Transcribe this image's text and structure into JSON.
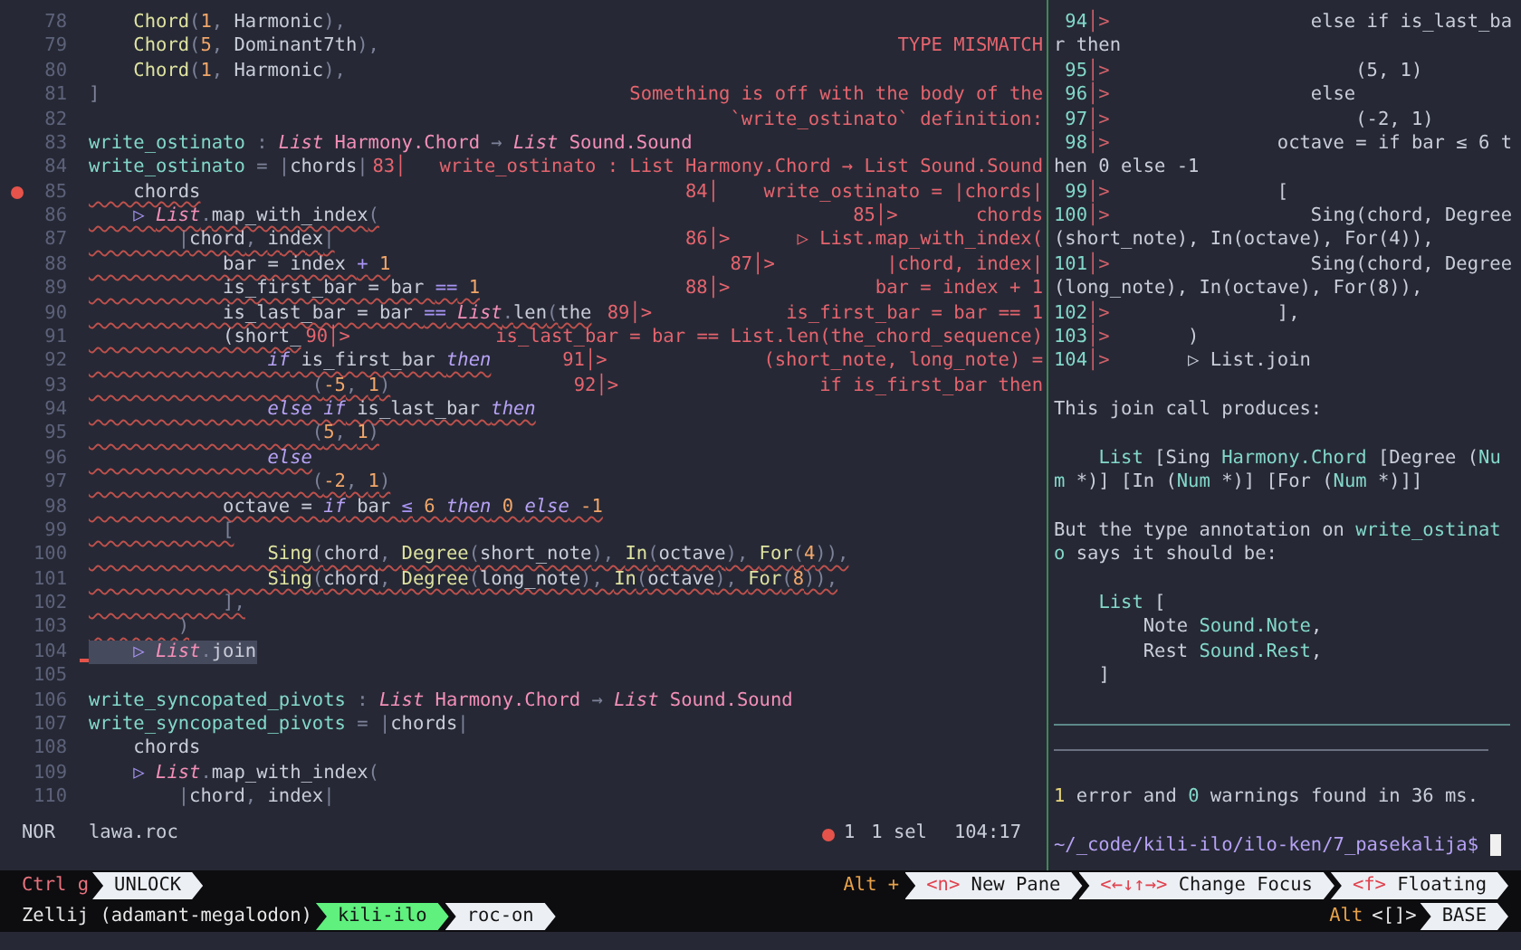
{
  "editor": {
    "lines": [
      {
        "number": "78",
        "tokens": [
          {
            "kind": "fn",
            "text": "    Chord"
          },
          {
            "kind": "p",
            "text": "("
          },
          {
            "kind": "num",
            "text": "1"
          },
          {
            "kind": "p",
            "text": ", "
          },
          {
            "kind": "pl",
            "text": "Harmonic"
          },
          {
            "kind": "p",
            "text": "),"
          }
        ],
        "error": false,
        "breakpoint": false,
        "selected": false
      },
      {
        "number": "79",
        "tokens": [
          {
            "kind": "fn",
            "text": "    Chord"
          },
          {
            "kind": "p",
            "text": "("
          },
          {
            "kind": "num",
            "text": "5"
          },
          {
            "kind": "p",
            "text": ", "
          },
          {
            "kind": "pl",
            "text": "Dominant7th"
          },
          {
            "kind": "p",
            "text": "),"
          }
        ],
        "diagnostic": "TYPE MISMATCH",
        "error": false,
        "breakpoint": false,
        "selected": false
      },
      {
        "number": "80",
        "tokens": [
          {
            "kind": "fn",
            "text": "    Chord"
          },
          {
            "kind": "p",
            "text": "("
          },
          {
            "kind": "num",
            "text": "1"
          },
          {
            "kind": "p",
            "text": ", "
          },
          {
            "kind": "pl",
            "text": "Harmonic"
          },
          {
            "kind": "p",
            "text": "),"
          }
        ],
        "error": false,
        "breakpoint": false,
        "selected": false
      },
      {
        "number": "81",
        "tokens": [
          {
            "kind": "p",
            "text": "]"
          }
        ],
        "diagnostic": "Something is off with the body of the",
        "error": false,
        "breakpoint": false,
        "selected": false
      },
      {
        "number": "82",
        "diagnostic": "`write_ostinato` definition:",
        "error": false,
        "breakpoint": false,
        "selected": false
      },
      {
        "number": "83",
        "tokens": [
          {
            "kind": "def",
            "text": "write_ostinato"
          },
          {
            "kind": "p",
            "text": " : "
          },
          {
            "kind": "ti",
            "text": "List"
          },
          {
            "kind": "ty",
            "text": " Harmony.Chord"
          },
          {
            "kind": "p",
            "text": " → "
          },
          {
            "kind": "ti",
            "text": "List"
          },
          {
            "kind": "ty",
            "text": " Sound.Sound"
          }
        ],
        "error": false,
        "breakpoint": false,
        "selected": false
      },
      {
        "number": "84",
        "tokens": [
          {
            "kind": "def",
            "text": "write_ostinato"
          },
          {
            "kind": "p",
            "text": " = |"
          },
          {
            "kind": "pl",
            "text": "chords"
          },
          {
            "kind": "p",
            "text": "|"
          }
        ],
        "diagnostic": "83│   write_ostinato : List Harmony.Chord → List Sound.Sound",
        "error": false,
        "breakpoint": false,
        "selected": false
      },
      {
        "number": "85",
        "tokens": [
          {
            "kind": "pl",
            "text": "    chords"
          }
        ],
        "diagnostic": "84│    write_ostinato = |chords|",
        "error": true,
        "breakpoint": true,
        "selected": false
      },
      {
        "number": "86",
        "tokens": [
          {
            "kind": "op",
            "text": "    ▷ "
          },
          {
            "kind": "ti",
            "text": "List"
          },
          {
            "kind": "p",
            "text": "."
          },
          {
            "kind": "pl",
            "text": "map_with_index"
          },
          {
            "kind": "p",
            "text": "("
          }
        ],
        "diagnostic": "85│>       chords",
        "error": true,
        "breakpoint": false,
        "selected": false
      },
      {
        "number": "87",
        "tokens": [
          {
            "kind": "p",
            "text": "        |"
          },
          {
            "kind": "pl",
            "text": "chord"
          },
          {
            "kind": "p",
            "text": ", "
          },
          {
            "kind": "pl",
            "text": "index"
          },
          {
            "kind": "p",
            "text": "|"
          }
        ],
        "diagnostic": "86│>      ▷ List.map_with_index(",
        "error": true,
        "breakpoint": false,
        "selected": false
      },
      {
        "number": "88",
        "tokens": [
          {
            "kind": "pl",
            "text": "            bar = index "
          },
          {
            "kind": "op",
            "text": "+"
          },
          {
            "kind": "num",
            "text": " 1"
          }
        ],
        "diagnostic": "87│>          |chord, index|",
        "error": true,
        "breakpoint": false,
        "selected": false
      },
      {
        "number": "89",
        "tokens": [
          {
            "kind": "pl",
            "text": "            is_first_bar = bar "
          },
          {
            "kind": "op",
            "text": "=="
          },
          {
            "kind": "num",
            "text": " 1"
          }
        ],
        "diagnostic": "88│>             bar = index + 1",
        "error": true,
        "breakpoint": false,
        "selected": false
      },
      {
        "number": "90",
        "tokens": [
          {
            "kind": "pl",
            "text": "            is_last_bar = bar "
          },
          {
            "kind": "op",
            "text": "=="
          },
          {
            "kind": "ti",
            "text": " List"
          },
          {
            "kind": "p",
            "text": "."
          },
          {
            "kind": "pl",
            "text": "len"
          },
          {
            "kind": "p",
            "text": "("
          },
          {
            "kind": "pl",
            "text": "the"
          }
        ],
        "diagnostic": "89│>            is_first_bar = bar == 1",
        "error": true,
        "breakpoint": false,
        "selected": false
      },
      {
        "number": "91",
        "tokens": [
          {
            "kind": "pl",
            "text": "            (short_"
          }
        ],
        "diagnostic": "90│>             is_last_bar = bar == List.len(the_chord_sequence)",
        "error": true,
        "breakpoint": false,
        "selected": false
      },
      {
        "number": "92",
        "tokens": [
          {
            "kind": "kw",
            "text": "                if"
          },
          {
            "kind": "pl",
            "text": " is_first_bar "
          },
          {
            "kind": "kw",
            "text": "then"
          }
        ],
        "diagnostic": "91│>              (short_note, long_note) =",
        "error": true,
        "breakpoint": false,
        "selected": false
      },
      {
        "number": "93",
        "tokens": [
          {
            "kind": "p",
            "text": "                    ("
          },
          {
            "kind": "num",
            "text": "-5"
          },
          {
            "kind": "p",
            "text": ", "
          },
          {
            "kind": "num",
            "text": "1"
          },
          {
            "kind": "p",
            "text": ")"
          }
        ],
        "diagnostic": "92│>                  if is_first_bar then",
        "error": true,
        "breakpoint": false,
        "selected": false
      },
      {
        "number": "94",
        "tokens": [
          {
            "kind": "kw",
            "text": "                else if"
          },
          {
            "kind": "pl",
            "text": " is_last_bar "
          },
          {
            "kind": "kw",
            "text": "then"
          }
        ],
        "error": true,
        "breakpoint": false,
        "selected": false
      },
      {
        "number": "95",
        "tokens": [
          {
            "kind": "p",
            "text": "                    ("
          },
          {
            "kind": "num",
            "text": "5"
          },
          {
            "kind": "p",
            "text": ", "
          },
          {
            "kind": "num",
            "text": "1"
          },
          {
            "kind": "p",
            "text": ")"
          }
        ],
        "error": true,
        "breakpoint": false,
        "selected": false
      },
      {
        "number": "96",
        "tokens": [
          {
            "kind": "kw",
            "text": "                else"
          }
        ],
        "error": true,
        "breakpoint": false,
        "selected": false
      },
      {
        "number": "97",
        "tokens": [
          {
            "kind": "p",
            "text": "                    ("
          },
          {
            "kind": "num",
            "text": "-2"
          },
          {
            "kind": "p",
            "text": ", "
          },
          {
            "kind": "num",
            "text": "1"
          },
          {
            "kind": "p",
            "text": ")"
          }
        ],
        "error": true,
        "breakpoint": false,
        "selected": false
      },
      {
        "number": "98",
        "tokens": [
          {
            "kind": "pl",
            "text": "            octave = "
          },
          {
            "kind": "kw",
            "text": "if"
          },
          {
            "kind": "pl",
            "text": " bar "
          },
          {
            "kind": "op",
            "text": "≤"
          },
          {
            "kind": "num",
            "text": " 6 "
          },
          {
            "kind": "kw",
            "text": "then"
          },
          {
            "kind": "num",
            "text": " 0 "
          },
          {
            "kind": "kw",
            "text": "else"
          },
          {
            "kind": "num",
            "text": " -1"
          }
        ],
        "error": true,
        "breakpoint": false,
        "selected": false
      },
      {
        "number": "99",
        "tokens": [
          {
            "kind": "p",
            "text": "            ["
          }
        ],
        "error": true,
        "breakpoint": false,
        "selected": false
      },
      {
        "number": "100",
        "tokens": [
          {
            "kind": "fn",
            "text": "                Sing"
          },
          {
            "kind": "p",
            "text": "("
          },
          {
            "kind": "pl",
            "text": "chord"
          },
          {
            "kind": "p",
            "text": ", "
          },
          {
            "kind": "fn",
            "text": "Degree"
          },
          {
            "kind": "p",
            "text": "("
          },
          {
            "kind": "pl",
            "text": "short_note"
          },
          {
            "kind": "p",
            "text": "), "
          },
          {
            "kind": "fn",
            "text": "In"
          },
          {
            "kind": "p",
            "text": "("
          },
          {
            "kind": "pl",
            "text": "octave"
          },
          {
            "kind": "p",
            "text": "), "
          },
          {
            "kind": "fn",
            "text": "For"
          },
          {
            "kind": "p",
            "text": "("
          },
          {
            "kind": "num",
            "text": "4"
          },
          {
            "kind": "p",
            "text": ")),"
          }
        ],
        "error": true,
        "breakpoint": false,
        "selected": false
      },
      {
        "number": "101",
        "tokens": [
          {
            "kind": "fn",
            "text": "                Sing"
          },
          {
            "kind": "p",
            "text": "("
          },
          {
            "kind": "pl",
            "text": "chord"
          },
          {
            "kind": "p",
            "text": ", "
          },
          {
            "kind": "fn",
            "text": "Degree"
          },
          {
            "kind": "p",
            "text": "("
          },
          {
            "kind": "pl",
            "text": "long_note"
          },
          {
            "kind": "p",
            "text": "), "
          },
          {
            "kind": "fn",
            "text": "In"
          },
          {
            "kind": "p",
            "text": "("
          },
          {
            "kind": "pl",
            "text": "octave"
          },
          {
            "kind": "p",
            "text": "), "
          },
          {
            "kind": "fn",
            "text": "For"
          },
          {
            "kind": "p",
            "text": "("
          },
          {
            "kind": "num",
            "text": "8"
          },
          {
            "kind": "p",
            "text": ")),"
          }
        ],
        "error": true,
        "breakpoint": false,
        "selected": false
      },
      {
        "number": "102",
        "tokens": [
          {
            "kind": "p",
            "text": "            ],"
          }
        ],
        "error": true,
        "breakpoint": false,
        "selected": false
      },
      {
        "number": "103",
        "tokens": [
          {
            "kind": "p",
            "text": "        )"
          }
        ],
        "error": true,
        "breakpoint": false,
        "selected": false
      },
      {
        "number": "104",
        "tokens": [
          {
            "kind": "op",
            "text": "    ▷ "
          },
          {
            "kind": "ti",
            "text": "List"
          },
          {
            "kind": "p",
            "text": "."
          },
          {
            "kind": "pl",
            "text": "join"
          }
        ],
        "error": false,
        "breakpoint": false,
        "selected": true
      },
      {
        "number": "105",
        "error": false,
        "breakpoint": false,
        "selected": false
      },
      {
        "number": "106",
        "tokens": [
          {
            "kind": "def",
            "text": "write_syncopated_pivots"
          },
          {
            "kind": "p",
            "text": " : "
          },
          {
            "kind": "ti",
            "text": "List"
          },
          {
            "kind": "ty",
            "text": " Harmony.Chord"
          },
          {
            "kind": "p",
            "text": " → "
          },
          {
            "kind": "ti",
            "text": "List"
          },
          {
            "kind": "ty",
            "text": " Sound.Sound"
          }
        ],
        "error": false,
        "breakpoint": false,
        "selected": false
      },
      {
        "number": "107",
        "tokens": [
          {
            "kind": "def",
            "text": "write_syncopated_pivots"
          },
          {
            "kind": "p",
            "text": " = |"
          },
          {
            "kind": "pl",
            "text": "chords"
          },
          {
            "kind": "p",
            "text": "|"
          }
        ],
        "error": false,
        "breakpoint": false,
        "selected": false
      },
      {
        "number": "108",
        "tokens": [
          {
            "kind": "pl",
            "text": "    chords"
          }
        ],
        "error": false,
        "breakpoint": false,
        "selected": false
      },
      {
        "number": "109",
        "tokens": [
          {
            "kind": "op",
            "text": "    ▷ "
          },
          {
            "kind": "ti",
            "text": "List"
          },
          {
            "kind": "p",
            "text": "."
          },
          {
            "kind": "pl",
            "text": "map_with_index"
          },
          {
            "kind": "p",
            "text": "("
          }
        ],
        "error": false,
        "breakpoint": false,
        "selected": false
      },
      {
        "number": "110",
        "tokens": [
          {
            "kind": "p",
            "text": "        |"
          },
          {
            "kind": "pl",
            "text": "chord"
          },
          {
            "kind": "p",
            "text": ", "
          },
          {
            "kind": "pl",
            "text": "index"
          },
          {
            "kind": "p",
            "text": "|"
          }
        ],
        "error": false,
        "breakpoint": false,
        "selected": false
      }
    ]
  },
  "status_line": {
    "mode": "NOR",
    "file": "lawa.roc",
    "errors": "1",
    "selection": "1 sel",
    "position": "104:17"
  },
  "compiler_output": {
    "snippet": [
      {
        "number": "94",
        "gutter": "│>",
        "code": "                  else if is_last_bar then"
      },
      {
        "number": "95",
        "gutter": "│>",
        "code": "                      (5, 1)"
      },
      {
        "number": "96",
        "gutter": "│>",
        "code": "                  else"
      },
      {
        "number": "97",
        "gutter": "│>",
        "code": "                      (-2, 1)"
      },
      {
        "number": "98",
        "gutter": "│>",
        "code": "               octave = if bar ≤ 6 then 0 else -1"
      },
      {
        "number": "99",
        "gutter": "│>",
        "code": "               ["
      },
      {
        "number": "100",
        "gutter": "│>",
        "code": "                  Sing(chord, Degree(short_note), In(octave), For(4)),"
      },
      {
        "number": "101",
        "gutter": "│>",
        "code": "                  Sing(chord, Degree(long_note), In(octave), For(8)),"
      },
      {
        "number": "102",
        "gutter": "│>",
        "code": "               ],"
      },
      {
        "number": "103",
        "gutter": "│>",
        "code": "       )"
      },
      {
        "number": "104",
        "gutter": "│>",
        "code": "       ▷ List.join"
      }
    ],
    "intro": "This join call produces:",
    "produced_type": [
      {
        "kind": "def",
        "text": "    List"
      },
      {
        "kind": "pl",
        "text": " [Sing "
      },
      {
        "kind": "def",
        "text": "Harmony.Chord"
      },
      {
        "kind": "pl",
        "text": " [Degree ("
      },
      {
        "kind": "def",
        "text": "Num"
      },
      {
        "kind": "pl",
        "text": " *)] [In ("
      },
      {
        "kind": "def",
        "text": "Num"
      },
      {
        "kind": "pl",
        "text": " *)] [For ("
      },
      {
        "kind": "def",
        "text": "Num"
      },
      {
        "kind": "pl",
        "text": " *)]]"
      }
    ],
    "annotation_note": [
      {
        "kind": "pl",
        "text": "But the type annotation on "
      },
      {
        "kind": "def",
        "text": "write_ostinato"
      },
      {
        "kind": "pl",
        "text": " says it should be:"
      }
    ],
    "expected_type": [
      [
        {
          "kind": "def",
          "text": "    List"
        },
        {
          "kind": "pl",
          "text": " ["
        }
      ],
      [
        {
          "kind": "pl",
          "text": "        Note "
        },
        {
          "kind": "def",
          "text": "Sound.Note"
        },
        {
          "kind": "pl",
          "text": ","
        }
      ],
      [
        {
          "kind": "pl",
          "text": "        Rest "
        },
        {
          "kind": "def",
          "text": "Sound.Rest"
        },
        {
          "kind": "pl",
          "text": ","
        }
      ],
      [
        {
          "kind": "pl",
          "text": "    ]"
        }
      ]
    ],
    "summary": [
      {
        "kind": "warn",
        "text": "1"
      },
      {
        "kind": "pl",
        "text": " error and "
      },
      {
        "kind": "def",
        "text": "0"
      },
      {
        "kind": "pl",
        "text": " warnings found in 36 ms."
      }
    ],
    "prompt": "~/_code/kili-ilo/ilo-ken/7_pasekalija$"
  },
  "zellij": {
    "mode_key": "Ctrl g",
    "mode_button": "UNLOCK",
    "shortcut_prefix": "Alt +",
    "shortcuts": [
      {
        "key": "<n>",
        "label": "New Pane"
      },
      {
        "key": "<←↓↑→>",
        "label": "Change Focus"
      },
      {
        "key": "<f>",
        "label": "Floating"
      }
    ],
    "session": "Zellij (adamant-megalodon)",
    "tabs": [
      {
        "label": "kili-ilo",
        "selected": true
      },
      {
        "label": "roc-on",
        "selected": false
      }
    ],
    "swap_prefix": "Alt",
    "swap_key": "<[]>",
    "layout": "BASE"
  }
}
